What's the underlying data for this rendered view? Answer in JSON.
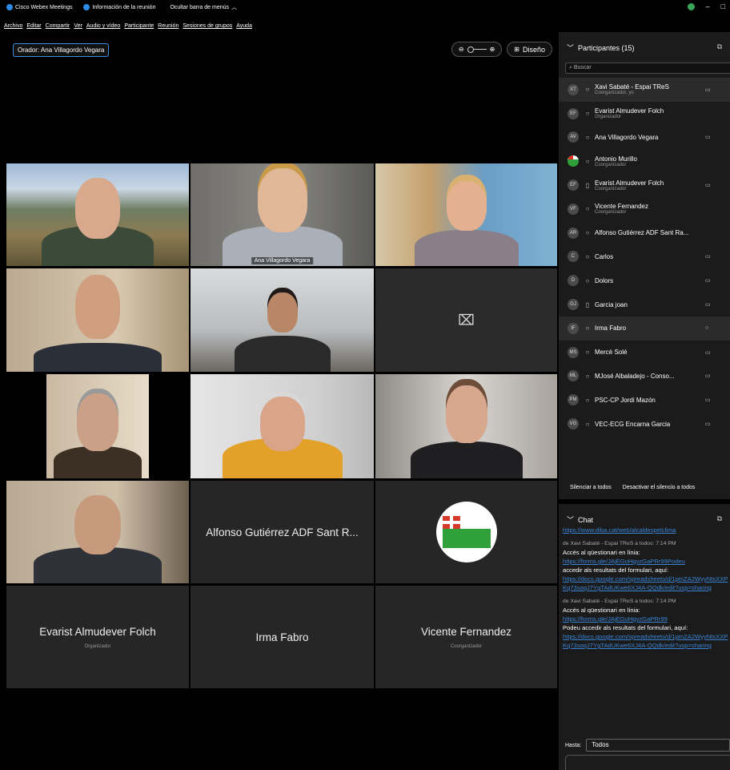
{
  "titlebar": {
    "app": "Cisco Webex Meetings",
    "info": "Información de la reunión",
    "hide_menu": "Ocultar barra de menús",
    "window_controls": [
      "–",
      "□"
    ]
  },
  "menu": [
    "Archivo",
    "Editar",
    "Compartir",
    "Ver",
    "Audio y vídeo",
    "Participante",
    "Reunión",
    "Sesiones de grupos",
    "Ayuda"
  ],
  "stage": {
    "speaker": "Orador: Ana Villagordo Vegara",
    "layout_button": "Diseño"
  },
  "tiles": {
    "active_label": "Ana Villagordo Vegara",
    "alfonso": "Alfonso Gutiérrez ADF Sant R...",
    "evarist": {
      "name": "Evarist Almudever Folch",
      "role": "Organizador"
    },
    "irma": {
      "name": "Irma Fabro"
    },
    "vicente": {
      "name": "Vicente Fernandez",
      "role": "Coorganizador"
    }
  },
  "participants": {
    "header": "Participantes (15)",
    "search_placeholder": "Buscar",
    "items": [
      {
        "initials": "XT",
        "name": "Xavi Sabaté - Espai TReS",
        "role": "Coorganizador, yo",
        "cam": "▭",
        "mic": "○"
      },
      {
        "initials": "EF",
        "name": "Evarist Almudever Folch",
        "role": "Organizador",
        "cam": "",
        "mic": "○"
      },
      {
        "initials": "AV",
        "name": "Ana Villagordo Vegara",
        "role": "",
        "cam": "▭",
        "mic": "○"
      },
      {
        "initials": "",
        "name": "Antonio Murillo",
        "role": "Coorganizador",
        "cam": "",
        "mic": "○"
      },
      {
        "initials": "EF",
        "name": "Evarist Almudever Folch",
        "role": "Coorganizador",
        "cam": "▭",
        "mic": "▯"
      },
      {
        "initials": "VF",
        "name": "Vicente Fernandez",
        "role": "Coorganizador",
        "cam": "",
        "mic": "○"
      },
      {
        "initials": "AR",
        "name": "Alfonso Gutiérrez ADF Sant Ra...",
        "role": "",
        "cam": "",
        "mic": "○"
      },
      {
        "initials": "C",
        "name": "Carlos",
        "role": "",
        "cam": "▭",
        "mic": "○"
      },
      {
        "initials": "D",
        "name": "Dolors",
        "role": "",
        "cam": "▭",
        "mic": "○"
      },
      {
        "initials": "GJ",
        "name": "Garcia joan",
        "role": "",
        "cam": "▭",
        "mic": "▯"
      },
      {
        "initials": "IF",
        "name": "Irma Fabro",
        "role": "",
        "cam": "○",
        "mic": "○"
      },
      {
        "initials": "MS",
        "name": "Mercè Solé",
        "role": "",
        "cam": "▭",
        "mic": "○"
      },
      {
        "initials": "ML",
        "name": "MJosé Albaladejo - Conso...",
        "role": "",
        "cam": "▭",
        "mic": "○"
      },
      {
        "initials": "PM",
        "name": "PSC-CP Jordi Mazón",
        "role": "",
        "cam": "▭",
        "mic": "○"
      },
      {
        "initials": "VG",
        "name": "VEC-ECG Encarna Garcia",
        "role": "",
        "cam": "▭",
        "mic": "○"
      }
    ],
    "mute_all": "Silenciar a todos",
    "unmute_all": "Desactivar el silencio a todos"
  },
  "chat": {
    "header": "Chat",
    "link0": "https://www.diba.cat/web/alcaldespelclima",
    "msg1": {
      "meta": "de Xavi Sabaté - Espai TReS a todos:   7:14 PM",
      "text1": "Accés al qüestionari en línia:",
      "link1": "https://forms.gle/JAjEGuHgyzGaPRr99Podeu",
      "text2": "accedir als resultats del formulari, aquí:",
      "link2": "https://docs.google.com/spreadsheets/d/1pmZA2WyyNtxXXPKq73soqJ7YgTAdUKwe6XJ4A-QQdk/edit?usp=sharing"
    },
    "msg2": {
      "meta": "de Xavi Sabaté - Espai TReS a todos:   7:14 PM",
      "text1": "Accés al qüestionari en línia:",
      "link1": "https://forms.gle/JAjEGuHgyzGaPRr99",
      "text2": " Podeu accedir als resultats del formulari, aquí:",
      "link2": "https://docs.google.com/spreadsheets/d/1pmZA2WyyNtxXXPKq73soqJ7YgTAdUKwe6XJ4A-QQdk/edit?usp=sharing"
    },
    "to_label": "Hasta:",
    "to_value": "Todos"
  }
}
